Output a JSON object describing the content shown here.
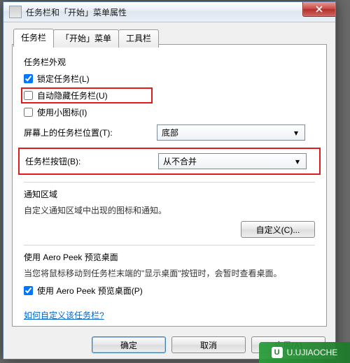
{
  "window": {
    "title": "任务栏和「开始」菜单属性"
  },
  "tabs": {
    "items": [
      {
        "label": "任务栏"
      },
      {
        "label": "「开始」菜单"
      },
      {
        "label": "工具栏"
      }
    ]
  },
  "taskbar": {
    "appearance_title": "任务栏外观",
    "lock_label": "锁定任务栏(L)",
    "autohide_label": "自动隐藏任务栏(U)",
    "smallicons_label": "使用小图标(I)",
    "position_label": "屏幕上的任务栏位置(T):",
    "position_value": "底部",
    "buttons_label": "任务栏按钮(B):",
    "buttons_value": "从不合并"
  },
  "notify": {
    "title": "通知区域",
    "desc": "自定义通知区域中出现的图标和通知。",
    "customize_btn": "自定义(C)..."
  },
  "aero": {
    "title": "使用 Aero Peek 预览桌面",
    "desc": "当您将鼠标移动到任务栏末端的\"显示桌面\"按钮时，会暂时查看桌面。",
    "checkbox_label": "使用 Aero Peek 预览桌面(P)"
  },
  "link": {
    "text": "如何自定义该任务栏?"
  },
  "footer": {
    "ok": "确定",
    "cancel": "取消",
    "apply": "应用(A)"
  },
  "watermark": {
    "text": "U.UJIAOCHE"
  }
}
